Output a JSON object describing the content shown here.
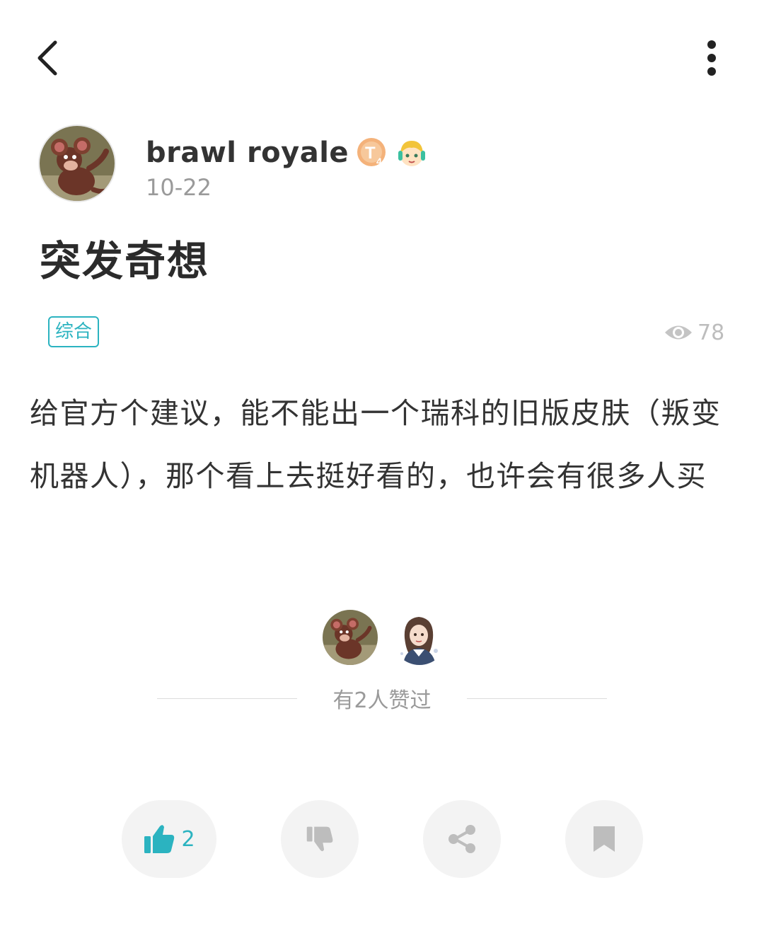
{
  "author": {
    "name": "brawl royale",
    "date": "10-22",
    "badge_icon": "tier-badge-icon",
    "badge_letter": "T",
    "badge_level": "4"
  },
  "post": {
    "title": "突发奇想",
    "tag": "综合",
    "views": "78",
    "body": "给官方个建议，能不能出一个瑞科的旧版皮肤（叛变机器人），那个看上去挺好看的，也许会有很多人买"
  },
  "likes": {
    "summary": "有2人赞过",
    "count": "2"
  },
  "colors": {
    "accent": "#2bb3c0",
    "muted": "#9a9a9a",
    "button_bg": "#f3f3f3"
  }
}
